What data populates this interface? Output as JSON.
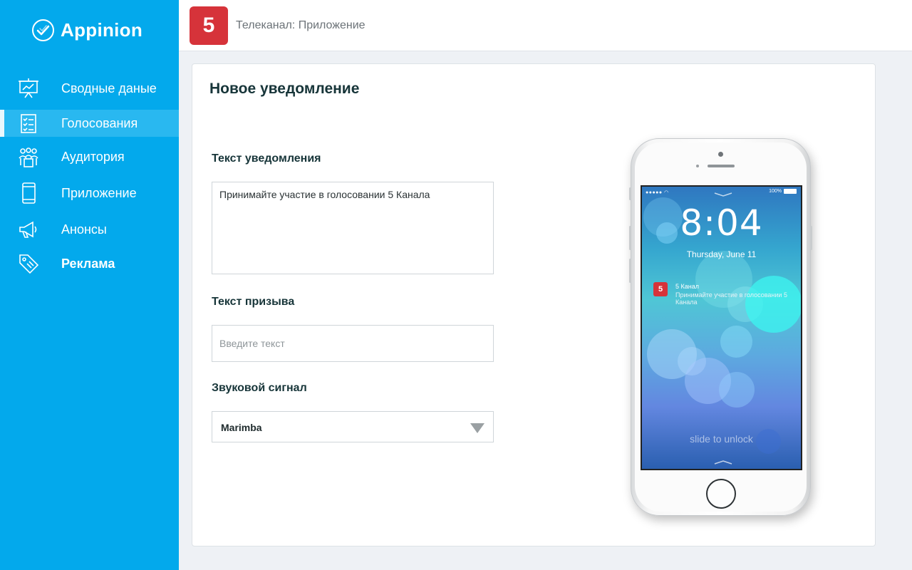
{
  "app": {
    "name": "Appinion"
  },
  "sidebar": {
    "items": [
      {
        "label": "Сводные даные",
        "icon": "presentation-chart-icon"
      },
      {
        "label": "Голосования",
        "icon": "checklist-icon",
        "active": true
      },
      {
        "label": "Аудитория",
        "icon": "audience-icon"
      },
      {
        "label": "Приложение",
        "icon": "mobile-phone-icon"
      },
      {
        "label": "Анонсы",
        "icon": "megaphone-icon"
      },
      {
        "label": "Реклама",
        "icon": "tag-icon",
        "bold": true
      }
    ]
  },
  "header": {
    "channel_logo": "5",
    "breadcrumb": "Телеканал: Приложение"
  },
  "form": {
    "title": "Новое уведомление",
    "notification_label": "Текст уведомления",
    "notification_value": "Принимайте участие в голосовании 5 Канала",
    "call_label": "Текст призыва",
    "call_placeholder": "Введите текст",
    "sound_label": "Звуковой сигнал",
    "sound_value": "Marimba"
  },
  "preview": {
    "battery": "100%",
    "time": "8:04",
    "date": "Thursday, June 11",
    "notif_icon": "5",
    "notif_title": "5 Канал",
    "notif_body": "Принимайте участие в голосовании 5 Канала",
    "slide_text": "slide to unlock"
  },
  "colors": {
    "sidebar": "#03a9ec",
    "sidebar_active": "#29b8f0",
    "brand_red": "#d6333a",
    "heading": "#173539"
  }
}
